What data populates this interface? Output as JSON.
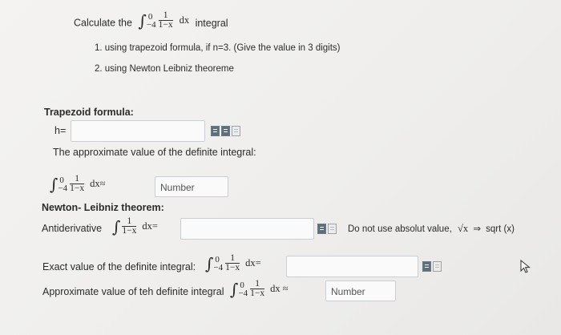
{
  "question": {
    "prefix": "Calculate the",
    "integrand_num": "1",
    "integrand_den": "1−x",
    "upper": "0",
    "lower": "−4",
    "dx": "dx",
    "suffix": "integral",
    "items": [
      "1. using trapezoid formula, if n=3.  (Give the value in 3 digits)",
      "2. using Newton Leibniz theoreme"
    ]
  },
  "trapezoid": {
    "heading": "Trapezoid formula:",
    "h_label": "h=",
    "approx_text": "The approximate value of the definite integral:",
    "integral_upper": "0",
    "integral_lower": "−4",
    "num": "1",
    "den": "1−x",
    "dx_approx": "dx≈",
    "placeholder": "Number"
  },
  "newton": {
    "heading": "Newton- Leibniz theorem:",
    "antideriv_label": "Antiderivative",
    "num": "1",
    "den": "1−x",
    "dx_eq": "dx=",
    "hint": "Do not use absolut value,",
    "hint_sqrt": "√x",
    "hint_arrow": "⇒",
    "hint_func": "sqrt (x)",
    "exact_label": "Exact value of the definite integral:",
    "exact_upper": "0",
    "exact_lower": "−4",
    "exact_dx": "dx=",
    "approx_label": "Approximate value of teh definite integral",
    "approx_upper": "0",
    "approx_lower": "−4",
    "approx_dx": "dx ≈",
    "approx_placeholder": "Number"
  }
}
